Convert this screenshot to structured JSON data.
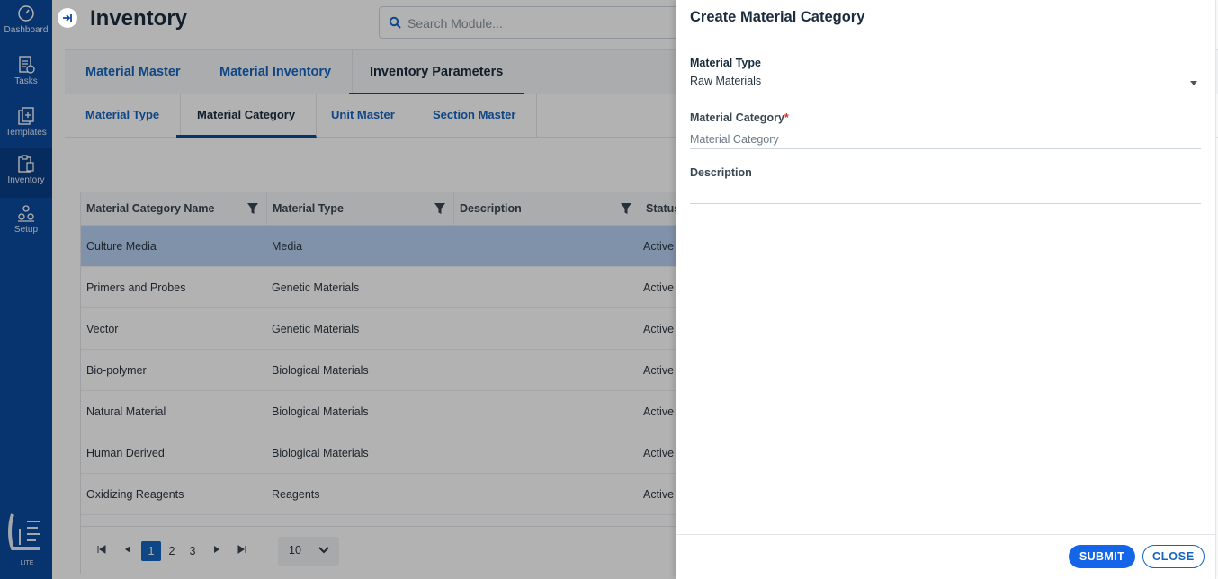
{
  "sidebar": {
    "items": [
      {
        "label": "Dashboard",
        "icon": "dashboard-icon"
      },
      {
        "label": "Tasks",
        "icon": "tasks-icon"
      },
      {
        "label": "Templates",
        "icon": "templates-icon"
      },
      {
        "label": "Inventory",
        "icon": "inventory-icon",
        "active": true
      },
      {
        "label": "Setup",
        "icon": "setup-icon"
      }
    ],
    "logo_text": "LITE"
  },
  "header": {
    "title": "Inventory",
    "search_placeholder": "Search Module..."
  },
  "main_tabs": [
    {
      "label": "Material Master"
    },
    {
      "label": "Material Inventory"
    },
    {
      "label": "Inventory Parameters",
      "active": true
    }
  ],
  "sub_tabs": [
    {
      "label": "Material Type"
    },
    {
      "label": "Material Category",
      "active": true
    },
    {
      "label": "Unit Master"
    },
    {
      "label": "Section Master"
    }
  ],
  "grid": {
    "columns": [
      "Material Category Name",
      "Material Type",
      "Description",
      "Status"
    ],
    "rows": [
      {
        "name": "Culture Media",
        "type": "Media",
        "description": "",
        "status": "Active",
        "selected": true
      },
      {
        "name": "Primers and Probes",
        "type": "Genetic Materials",
        "description": "",
        "status": "Active"
      },
      {
        "name": "Vector",
        "type": "Genetic Materials",
        "description": "",
        "status": "Active"
      },
      {
        "name": "Bio-polymer",
        "type": "Biological Materials",
        "description": "",
        "status": "Active"
      },
      {
        "name": "Natural Material",
        "type": "Biological Materials",
        "description": "",
        "status": "Active"
      },
      {
        "name": "Human Derived",
        "type": "Biological Materials",
        "description": "",
        "status": "Active"
      },
      {
        "name": "Oxidizing Reagents",
        "type": "Reagents",
        "description": "",
        "status": "Active"
      }
    ],
    "pager": {
      "pages": [
        "1",
        "2",
        "3"
      ],
      "current_page": "1",
      "page_size": "10"
    }
  },
  "drawer": {
    "title": "Create Material Category",
    "material_type_label": "Material Type",
    "material_type_value": "Raw Materials",
    "material_category_label": "Material Category",
    "material_category_placeholder": "Material Category",
    "description_label": "Description",
    "submit_label": "SUBMIT",
    "close_label": "CLOSE"
  },
  "colors": {
    "sidebar": "#0b4a9e",
    "accent": "#1565c0",
    "selected_row": "#b8d2f2",
    "submit": "#1565e8"
  }
}
